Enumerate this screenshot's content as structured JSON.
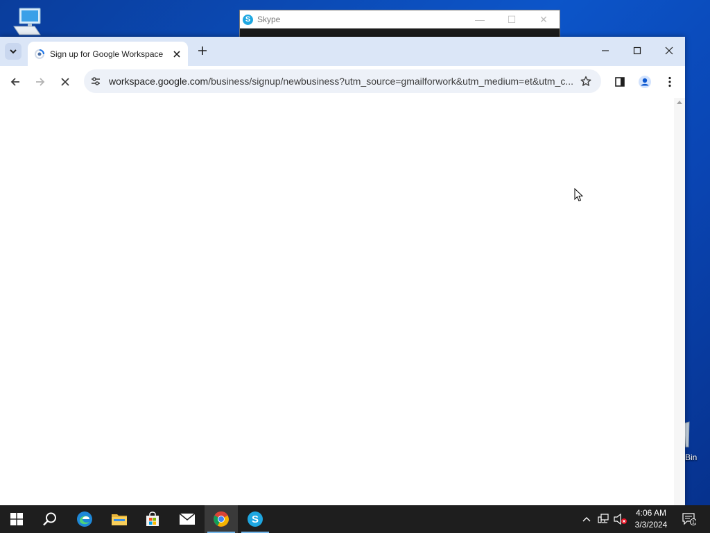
{
  "desktop": {
    "recycle_bin_label": "Bin"
  },
  "skype_window": {
    "title": "Skype",
    "logo_letter": "S"
  },
  "browser": {
    "tab": {
      "title": "Sign up for Google Workspace"
    },
    "address": {
      "host": "workspace.google.com",
      "path": "/business/signup/newbusiness?utm_source=gmailforwork&utm_medium=et&utm_c..."
    },
    "loading": true
  },
  "taskbar": {
    "clock_time": "4:06 AM",
    "clock_date": "3/3/2024",
    "notification_count": "1",
    "apps": [
      "start",
      "search",
      "edge",
      "file-explorer",
      "store",
      "mail",
      "chrome",
      "skype"
    ],
    "active_app": "chrome"
  },
  "colors": {
    "desktop_blue": "#0c55c9",
    "tabstrip": "#dbe6f7",
    "omnibox": "#edf1f8",
    "taskbar": "#1e1e1e"
  }
}
